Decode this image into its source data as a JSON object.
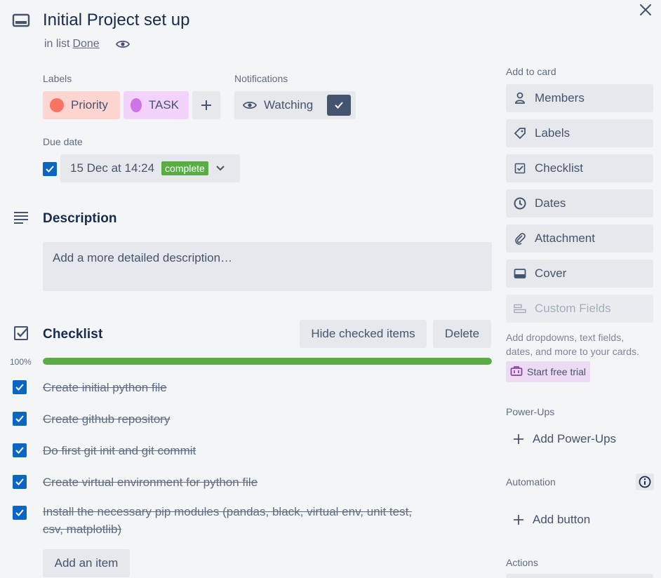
{
  "card": {
    "title": "Initial Project set up",
    "in_list_prefix": "in list",
    "list_name": "Done"
  },
  "labels": {
    "heading": "Labels",
    "items": [
      {
        "name": "Priority",
        "color": "#f87462",
        "bg": "#ffd5d2"
      },
      {
        "name": "TASK",
        "color": "#cd74e6",
        "bg": "#f3d2fb"
      }
    ]
  },
  "notifications": {
    "heading": "Notifications",
    "button_label": "Watching"
  },
  "due_date": {
    "heading": "Due date",
    "value": "15 Dec at 14:24",
    "status": "complete"
  },
  "description": {
    "heading": "Description",
    "placeholder": "Add a more detailed description…"
  },
  "checklist": {
    "heading": "Checklist",
    "hide_button": "Hide checked items",
    "delete_button": "Delete",
    "progress_label": "100%",
    "progress": 1.0,
    "items": [
      {
        "text": "Create initial python file",
        "checked": true
      },
      {
        "text": "Create github repository",
        "checked": true
      },
      {
        "text": "Do first git init and git commit",
        "checked": true
      },
      {
        "text": "Create virtual environment for python file",
        "checked": true
      },
      {
        "text_line1": "Install the necessary pip modules (pandas, black, virtual env, unit test,",
        "text_line2": "csv, matplotlib)",
        "checked": true
      }
    ],
    "add_item_button": "Add an item"
  },
  "sidebar": {
    "add_to_card_heading": "Add to card",
    "buttons": [
      {
        "label": "Members",
        "icon": "person-icon"
      },
      {
        "label": "Labels",
        "icon": "tag-icon"
      },
      {
        "label": "Checklist",
        "icon": "checklist-icon"
      },
      {
        "label": "Dates",
        "icon": "clock-icon"
      },
      {
        "label": "Attachment",
        "icon": "paperclip-icon"
      },
      {
        "label": "Cover",
        "icon": "cover-icon"
      },
      {
        "label": "Custom Fields",
        "icon": "custom-fields-icon",
        "disabled": true
      }
    ],
    "custom_fields_note": "Add dropdowns, text fields, dates, and more to your cards.",
    "trial_button": "Start free trial",
    "powerups_heading": "Power-Ups",
    "add_powerups": "Add Power-Ups",
    "automation_heading": "Automation",
    "add_button": "Add button",
    "actions_heading": "Actions"
  },
  "colors": {
    "accent_blue": "#0b66c3",
    "progress_green": "#5aac44",
    "background": "#f4f5f7"
  }
}
